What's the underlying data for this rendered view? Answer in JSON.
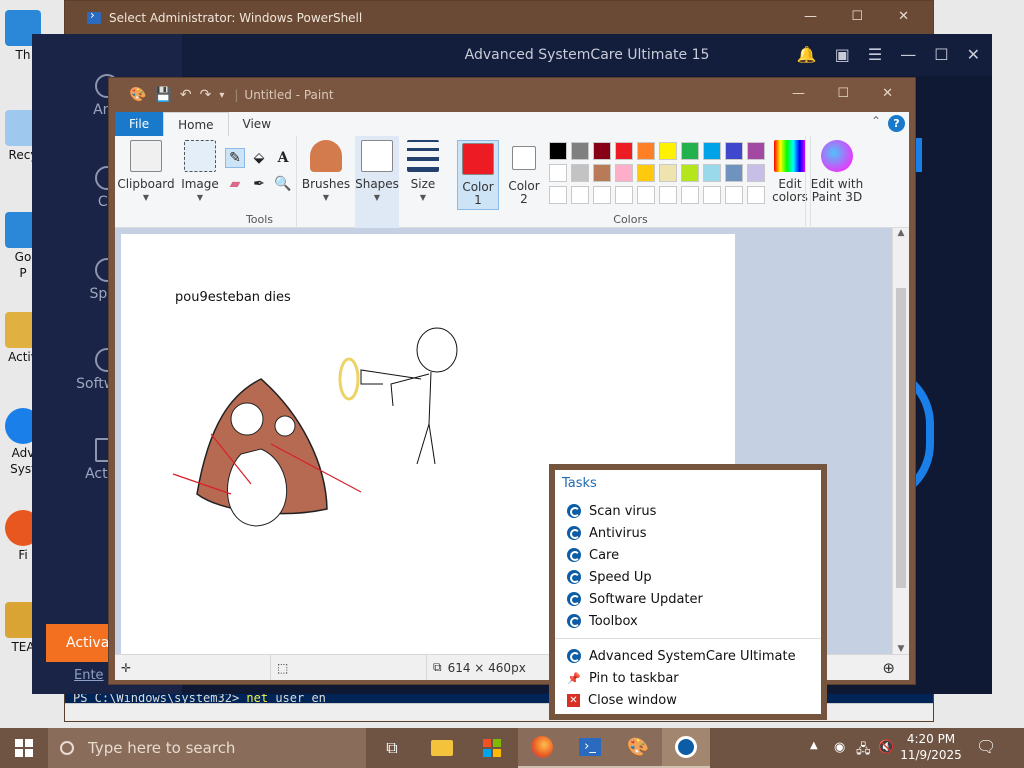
{
  "desktop": {
    "icons": [
      {
        "label": "Th",
        "color": "#2b88d8"
      },
      {
        "label": "Recy",
        "color": "#9ec8ee"
      },
      {
        "label": "Go",
        "color": "#2b88d8"
      },
      {
        "label": "Activ",
        "color": "#e0b040"
      },
      {
        "label": "Adv",
        "color": "#1a7fe8"
      },
      {
        "label": "Fi",
        "color": "#e8571f"
      },
      {
        "label": "TEA",
        "color": "#d9a433"
      }
    ],
    "partial_labels": [
      "P",
      "Syst"
    ]
  },
  "powershell": {
    "title": "Select Administrator: Windows PowerShell",
    "prompt": "PS C:\\Windows\\system32>",
    "command_start": "net",
    "command_rest": " user en"
  },
  "systemcare": {
    "title": "Advanced SystemCare Ultimate 15",
    "nav": [
      "Anti",
      "Ca",
      "Spee",
      "Software",
      "Action"
    ],
    "activate_label": "Activat",
    "enter_code_label": "Ente"
  },
  "paint": {
    "title": "Untitled - Paint",
    "tabs": {
      "file": "File",
      "home": "Home",
      "view": "View"
    },
    "ribbon": {
      "clipboard": "Clipboard",
      "image": "Image",
      "tools_label": "Tools",
      "brushes": "Brushes",
      "shapes": "Shapes",
      "size": "Size",
      "color1": "Color\n1",
      "color2": "Color\n2",
      "colors_label": "Colors",
      "edit_colors": "Edit\ncolors",
      "edit_paint3d": "Edit with\nPaint 3D"
    },
    "color1": "#ed1c24",
    "color2": "#ffffff",
    "palette_row1": [
      "#000000",
      "#7f7f7f",
      "#880015",
      "#ed1c24",
      "#ff7f27",
      "#fff200",
      "#22b14c",
      "#00a2e8",
      "#3f48cc",
      "#a349a4"
    ],
    "palette_row2": [
      "#ffffff",
      "#c3c3c3",
      "#b97a57",
      "#ffaec9",
      "#ffc90e",
      "#efe4b0",
      "#b5e61d",
      "#99d9ea",
      "#7092be",
      "#c8bfe7"
    ],
    "canvas_text": "pou9esteban dies",
    "status": {
      "size": "614 × 460px"
    }
  },
  "jumplist": {
    "header": "Tasks",
    "tasks": [
      "Scan virus",
      "Antivirus",
      "Care",
      "Speed Up",
      "Software Updater",
      "Toolbox"
    ],
    "app": "Advanced SystemCare Ultimate",
    "pin": "Pin to taskbar",
    "close": "Close window"
  },
  "taskbar": {
    "search_placeholder": "Type here to search",
    "time": "4:20 PM",
    "date": "11/9/2025"
  }
}
